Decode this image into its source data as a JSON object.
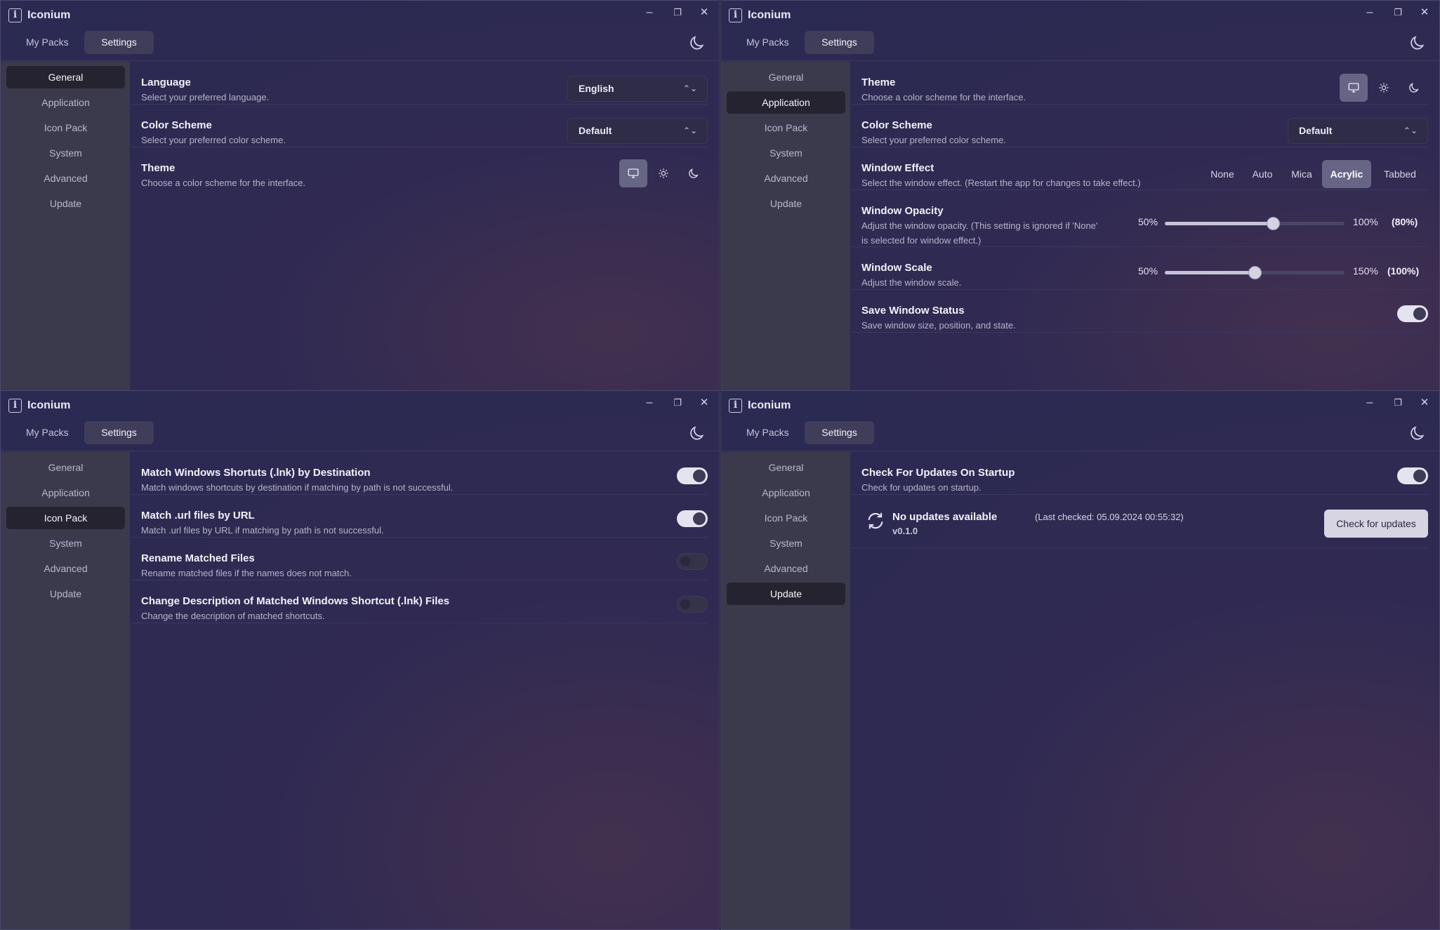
{
  "app": {
    "title": "Iconium",
    "tabs": [
      "My Packs",
      "Settings"
    ],
    "sidebar": [
      "General",
      "Application",
      "Icon Pack",
      "System",
      "Advanced",
      "Update"
    ]
  },
  "general": {
    "language": {
      "title": "Language",
      "desc": "Select your preferred language.",
      "value": "English"
    },
    "color_scheme": {
      "title": "Color Scheme",
      "desc": "Select your preferred color scheme.",
      "value": "Default"
    },
    "theme": {
      "title": "Theme",
      "desc": "Choose a color scheme for the interface.",
      "selected": "system"
    }
  },
  "application": {
    "theme": {
      "title": "Theme",
      "desc": "Choose a color scheme for the interface.",
      "selected": "system"
    },
    "color_scheme": {
      "title": "Color Scheme",
      "desc": "Select your preferred color scheme.",
      "value": "Default"
    },
    "window_effect": {
      "title": "Window Effect",
      "desc": "Select the window effect. (Restart the app for changes to take effect.)",
      "options": [
        "None",
        "Auto",
        "Mica",
        "Acrylic",
        "Tabbed"
      ],
      "selected": "Acrylic"
    },
    "window_opacity": {
      "title": "Window Opacity",
      "desc1": "Adjust the window opacity. (This setting is ignored if 'None'",
      "desc2": "is selected for window effect.)",
      "min_label": "50%",
      "max_label": "100%",
      "value_label": "(80%)",
      "min": 50,
      "max": 100,
      "value": 80
    },
    "window_scale": {
      "title": "Window Scale",
      "desc": "Adjust the window scale.",
      "min_label": "50%",
      "max_label": "150%",
      "value_label": "(100%)",
      "min": 50,
      "max": 150,
      "value": 100
    },
    "save_window_status": {
      "title": "Save Window Status",
      "desc": "Save window size, position, and state.",
      "on": true
    }
  },
  "icon_pack": {
    "match_lnk": {
      "title": "Match Windows Shortuts (.lnk) by Destination",
      "desc": "Match windows shortcuts by destination if matching by path is not successful.",
      "on": true
    },
    "match_url": {
      "title": "Match .url files by URL",
      "desc": "Match .url files by URL if matching by path is not successful.",
      "on": true
    },
    "rename": {
      "title": "Rename Matched Files",
      "desc": "Rename matched files if the names does not match.",
      "on": false
    },
    "change_desc": {
      "title": "Change Description of Matched Windows Shortcut (.lnk) Files",
      "desc": "Change the description of matched shortcuts.",
      "on": false
    }
  },
  "update": {
    "check_startup": {
      "title": "Check For Updates On Startup",
      "desc": "Check for updates on startup.",
      "on": true
    },
    "status": "No updates available",
    "last_checked": "(Last checked: 05.09.2024 00:55:32)",
    "version": "v0.1.0",
    "button": "Check for updates"
  },
  "colors": {
    "accent_toggle": "#e5e3ee",
    "selected_segment": "#676585",
    "sidebar_bg": "#3a3a4c"
  }
}
